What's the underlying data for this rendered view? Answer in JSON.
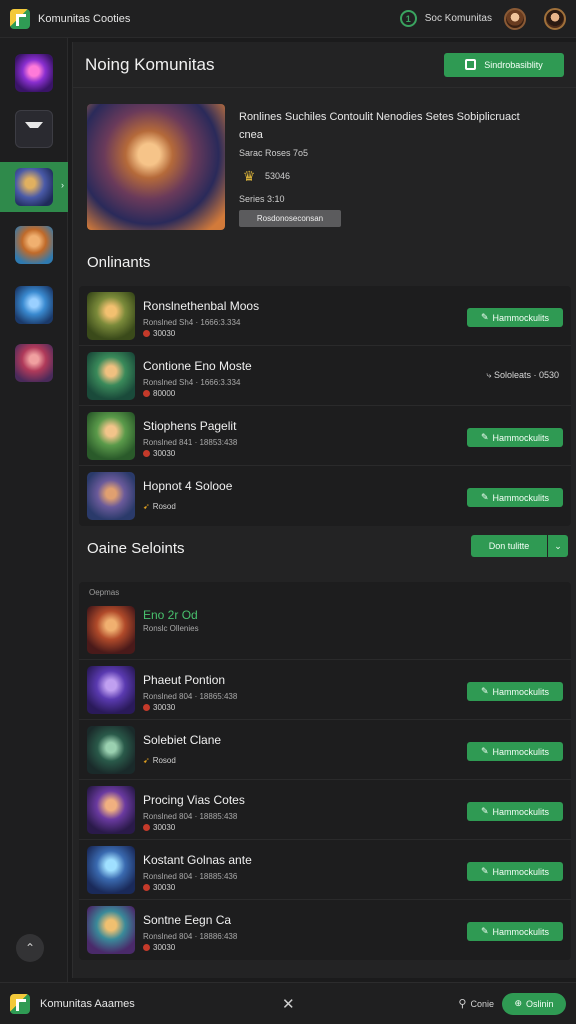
{
  "topbar": {
    "app_title": "Komunitas Cooties",
    "user_name": "Soc Komunitas"
  },
  "page": {
    "title": "Noing Komunitas",
    "manage_button": "Sindrobasiblity"
  },
  "featured": {
    "title": "Ronlines Suchiles Contoulit Nenodies Setes Sobiplicruact",
    "title_2": "cnea",
    "line_1": "Sarac Roses 7o5",
    "rating": "53046",
    "line_2": "Series 3:10",
    "tag": "Rosdonoseconsan"
  },
  "section_1": {
    "title": "Onlinants",
    "rows": [
      {
        "name": "Ronslnethenbal Moos",
        "meta": "Ronslned Sh4 · 1666:3.334",
        "sub": "30030",
        "action": "Hammockulits"
      },
      {
        "name": "Contione Eno Moste",
        "meta": "Ronslned Sh4 · 1666:3.334",
        "sub": "80000",
        "action": "Sololeats · 0530"
      },
      {
        "name": "Stiophens Pagelit",
        "meta": "Ronslned 841 · 18853:438",
        "sub": "30030",
        "action": "Hammockulits"
      },
      {
        "name": "Hopnot 4 Solooe",
        "meta": "",
        "sub": "Rosod",
        "action": "Hammockulits"
      }
    ]
  },
  "section_2": {
    "title": "Oaine Seloints",
    "sort_label": "Don tulitte",
    "caption": "Oepmas",
    "rows": [
      {
        "name": "Eno 2r Od",
        "meta": "Ronslc Ollenies",
        "sub": "",
        "action": ""
      },
      {
        "name": "Phaeut Pontion",
        "meta": "Ronslned 804 · 18865:438",
        "sub": "30030",
        "action": "Hammockulits"
      },
      {
        "name": "Solebiet Clane",
        "meta": "",
        "sub": "Rosod",
        "action": "Hammockulits"
      },
      {
        "name": "Procing Vias Cotes",
        "meta": "Ronslned 804 · 18885:438",
        "sub": "30030",
        "action": "Hammockulits"
      },
      {
        "name": "Kostant Golnas ante",
        "meta": "Ronslned 804 · 18885:436",
        "sub": "30030",
        "action": "Hammockulits"
      },
      {
        "name": "Sontne Eegn Ca",
        "meta": "Ronslned 804 · 18886:438",
        "sub": "30030",
        "action": "Hammockulits"
      }
    ]
  },
  "bottombar": {
    "title": "Komunitas Aaames",
    "location_label": "Conie",
    "action_button": "Oslinin"
  },
  "colors": {
    "accent": "#2f9a53",
    "background": "#1b1b1c",
    "panel": "#232324"
  },
  "icons": [
    "app-logo-icon",
    "status-circle-icon",
    "avatar",
    "pencil-icon",
    "chevron-down-icon",
    "close-icon",
    "location-pin-icon",
    "scroll-up-icon"
  ]
}
